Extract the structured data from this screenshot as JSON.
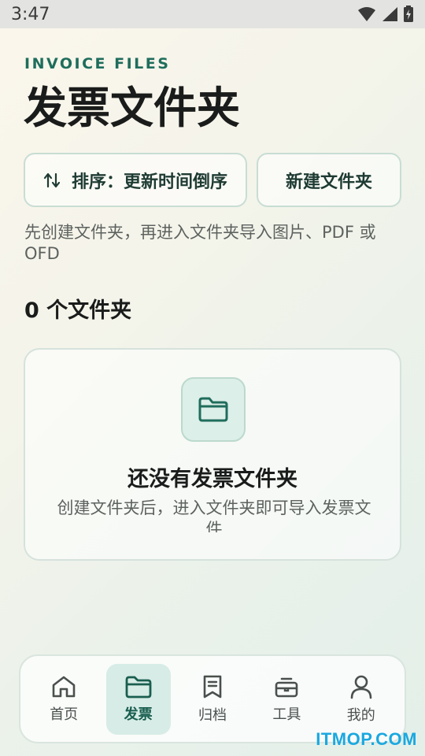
{
  "status_bar": {
    "time": "3:47"
  },
  "header": {
    "eyebrow": "INVOICE FILES",
    "title": "发票文件夹"
  },
  "actions": {
    "sort_label": "排序：更新时间倒序",
    "new_folder_label": "新建文件夹"
  },
  "hint": "先创建文件夹，再进入文件夹导入图片、PDF 或 OFD",
  "folder_count": "0 个文件夹",
  "empty_state": {
    "title": "还没有发票文件夹",
    "description": "创建文件夹后，进入文件夹即可导入发票文件"
  },
  "nav": {
    "items": [
      {
        "label": "首页",
        "icon": "home-icon"
      },
      {
        "label": "发票",
        "icon": "folder-icon",
        "active": true
      },
      {
        "label": "归档",
        "icon": "archive-book-icon"
      },
      {
        "label": "工具",
        "icon": "toolbox-icon"
      },
      {
        "label": "我的",
        "icon": "person-icon"
      }
    ]
  },
  "watermark": "ITMOP.COM",
  "colors": {
    "accent": "#1f6d5c",
    "active_nav_bg": "#d7ece6"
  }
}
